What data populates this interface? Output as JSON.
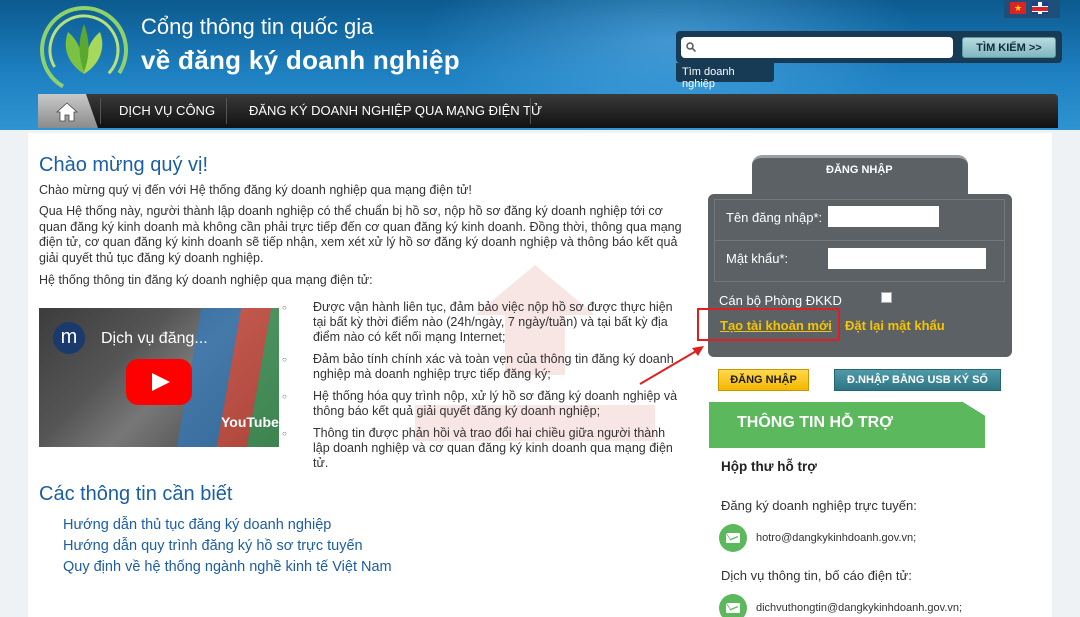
{
  "header": {
    "title_line1": "Cổng thông tin quốc gia",
    "title_line2": "về đăng ký doanh nghiệp",
    "languages": [
      "vn-flag-icon",
      "uk-flag-icon"
    ],
    "search": {
      "placeholder": "",
      "button_label": "TÌM KIẾM >>",
      "tab_label": "Tìm doanh nghiệp"
    },
    "nav": {
      "home_icon": "home-icon",
      "items": [
        "DỊCH VỤ CÔNG",
        "ĐĂNG KÝ DOANH NGHIỆP QUA MẠNG ĐIỆN TỬ"
      ]
    }
  },
  "main": {
    "welcome_title": "Chào mừng quý vị!",
    "p1": "Chào mừng quý vị đến với Hệ thống đăng ký doanh nghiệp qua mạng điện tử!",
    "p2": "Qua Hệ thống này, người thành lập doanh nghiệp có thể chuẩn bị hồ sơ, nộp hồ sơ đăng ký doanh nghiệp tới cơ quan đăng ký kinh doanh mà không cần phải trực tiếp đến cơ quan đăng ký kinh doanh. Đồng thời, thông qua mạng điện tử, cơ quan đăng ký kinh doanh sẽ tiếp nhận, xem xét xử lý hồ sơ đăng ký doanh nghiệp và thông báo kết quả giải quyết thủ tục đăng ký doanh nghiệp.",
    "p3": "Hệ thống thông tin đăng ký doanh nghiệp qua mạng điện tử:",
    "video": {
      "avatar_letter": "m",
      "title": "Dịch vụ đăng...",
      "brand": "YouTube"
    },
    "bullets": [
      "Được vận hành liên tục, đảm bảo việc nộp hồ sơ được thực hiện tại bất kỳ thời điểm nào (24h/ngày, 7 ngày/tuần) và tại bất kỳ địa điểm nào có kết nối mạng Internet;",
      "Đảm bảo tính chính xác và toàn vẹn của thông tin đăng ký doanh nghiệp mà doanh nghiệp trực tiếp đăng ký;",
      "Hệ thống hóa quy trình nộp, xử lý hồ sơ đăng ký doanh nghiệp và thông báo kết quả giải quyết đăng ký doanh nghiệp;",
      "Thông tin được phản hồi và trao đổi hai chiều giữa người thành lập doanh nghiệp và cơ quan đăng ký kinh doanh qua mạng điện tử."
    ],
    "info_title": "Các thông tin cần biết",
    "info_links": [
      "Hướng dẫn thủ tục đăng ký doanh nghiệp",
      "Hướng dẫn quy trình đăng ký hồ sơ trực tuyến",
      "Quy định về hệ thống ngành nghề kinh tế Việt Nam"
    ]
  },
  "login": {
    "tab_label": "ĐĂNG NHẬP",
    "username_label": "Tên đăng nhập*:",
    "password_label": "Mật khẩu*:",
    "username_value": "",
    "password_value": "",
    "staff_label": "Cán bộ Phòng ĐKKD",
    "create_account": "Tạo tài khoản mới",
    "reset_password": "Đặt lại mật khẩu",
    "login_button": "ĐĂNG NHẬP",
    "usb_button": "Đ.NHẬP BẰNG USB KÝ SỐ"
  },
  "support": {
    "title": "THÔNG TIN HỖ TRỢ",
    "subtitle": "Hộp thư hỗ trợ",
    "item1_label": "Đăng ký doanh nghiệp trực tuyến:",
    "item1_email": "hotro@dangkykinhdoanh.gov.vn;",
    "item2_label": "Dịch vụ thông tin, bố cáo điện tử:",
    "item2_email": "dichvuthongtin@dangkykinhdoanh.gov.vn;"
  },
  "colors": {
    "header_blue": "#1d7fc0",
    "link_blue": "#1b5ea3",
    "login_panel": "#5b6165",
    "accent_yellow": "#f6c400",
    "support_green": "#5cb85c",
    "annotation_red": "#e02020"
  }
}
